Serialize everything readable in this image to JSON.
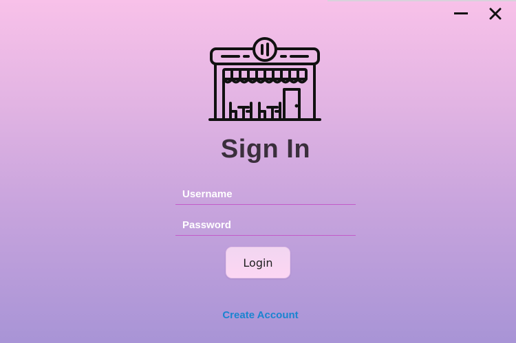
{
  "window": {
    "minimize_icon": "minimize-icon",
    "close_icon": "close-icon"
  },
  "logo": {
    "icon": "store-front-icon"
  },
  "title": "Sign In",
  "form": {
    "username_placeholder": "Username",
    "password_placeholder": "Password",
    "login_label": "Login"
  },
  "create_account_label": "Create Account",
  "colors": {
    "gradient_top": "#f8c1e9",
    "gradient_bottom": "#a894d6",
    "title": "#3a2f3c",
    "field_underline": "#c25bc8",
    "link": "#1a84d0",
    "button_bg": "#fcd6f3"
  }
}
